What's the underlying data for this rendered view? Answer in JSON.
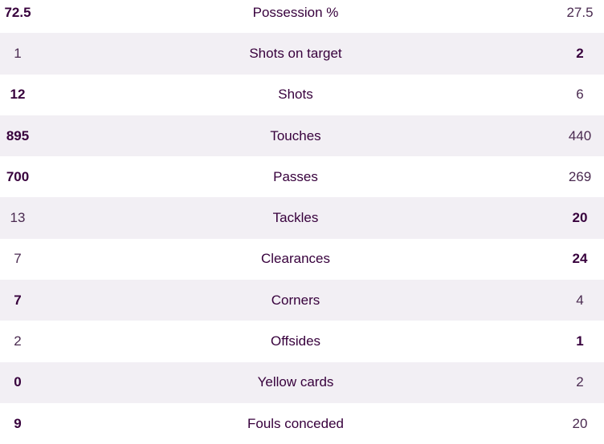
{
  "stats": [
    {
      "label": "Possession %",
      "home": "72.5",
      "away": "27.5",
      "leader": "home"
    },
    {
      "label": "Shots on target",
      "home": "1",
      "away": "2",
      "leader": "away"
    },
    {
      "label": "Shots",
      "home": "12",
      "away": "6",
      "leader": "home"
    },
    {
      "label": "Touches",
      "home": "895",
      "away": "440",
      "leader": "home"
    },
    {
      "label": "Passes",
      "home": "700",
      "away": "269",
      "leader": "home"
    },
    {
      "label": "Tackles",
      "home": "13",
      "away": "20",
      "leader": "away"
    },
    {
      "label": "Clearances",
      "home": "7",
      "away": "24",
      "leader": "away"
    },
    {
      "label": "Corners",
      "home": "7",
      "away": "4",
      "leader": "home"
    },
    {
      "label": "Offsides",
      "home": "2",
      "away": "1",
      "leader": "away"
    },
    {
      "label": "Yellow cards",
      "home": "0",
      "away": "2",
      "leader": "home"
    },
    {
      "label": "Fouls conceded",
      "home": "9",
      "away": "20",
      "leader": "home"
    }
  ],
  "colors": {
    "text": "#37003c",
    "stripe": "#f2eff4"
  }
}
